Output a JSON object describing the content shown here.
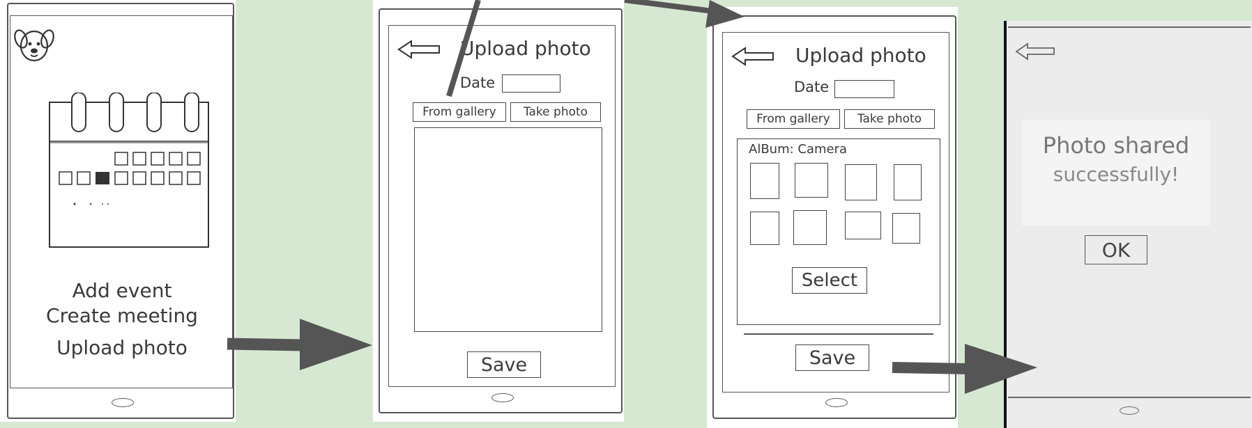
{
  "screens": {
    "home": {
      "menu": [
        "Add event",
        "Create meeting",
        "Upload photo"
      ]
    },
    "upload": {
      "title": "Upload photo",
      "date_label": "Date",
      "date_value": "",
      "from_gallery": "From gallery",
      "take_photo": "Take photo",
      "save": "Save"
    },
    "gallery": {
      "title": "Upload photo",
      "date_label": "Date",
      "date_value": "",
      "from_gallery": "From gallery",
      "take_photo": "Take photo",
      "album_label": "AlBum: Camera",
      "select": "Select",
      "save": "Save"
    },
    "confirm": {
      "message_line1": "Photo shared",
      "message_line2": "successfully!",
      "ok": "OK"
    }
  },
  "colors": {
    "background": "#d6e8d2",
    "paper": "#ffffff",
    "ink": "#3a3a3a",
    "arrow": "#555555"
  },
  "icons": [
    "dog-face-icon",
    "back-arrow-icon",
    "camera-icon"
  ]
}
